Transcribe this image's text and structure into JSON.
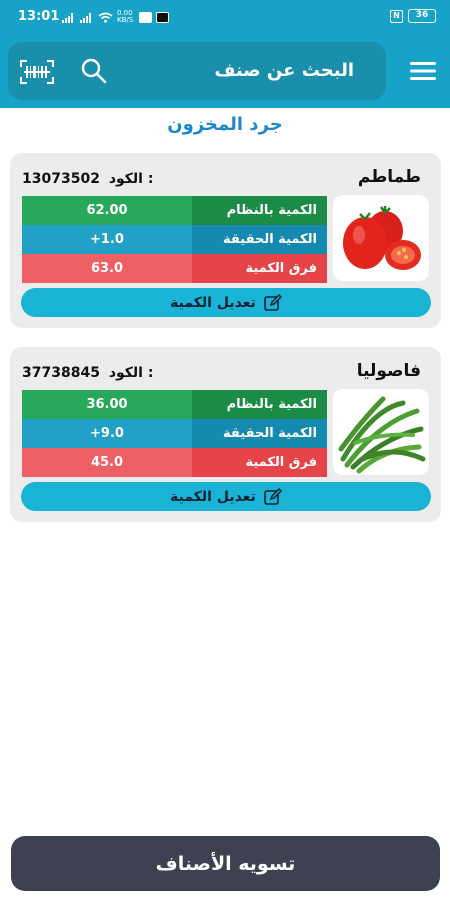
{
  "status_bar": {
    "time": "13:01",
    "data_speed": "0.00 KB/S",
    "battery": "36"
  },
  "app_bar": {
    "search_label": "البحث عن صنف",
    "menu_icon": "menu-icon",
    "search_icon": "search-icon",
    "barcode_icon": "barcode-scan-icon"
  },
  "page_title": "جرد المخزون",
  "colors": {
    "primary": "#17a2c8",
    "system_qty": "#1b8c46",
    "actual_qty": "#1689b0",
    "difference": "#e54448",
    "bottom_button": "#3d4150"
  },
  "items": [
    {
      "name": "طماطم",
      "code_label": "الكود :",
      "code": "13073502",
      "image": "tomato-image",
      "rows": [
        {
          "label": "الكمية بالنظام",
          "value": "62.00"
        },
        {
          "label": "الكمية الحقيقة",
          "value": "+1.0"
        },
        {
          "label": "فرق الكمية",
          "value": "63.0"
        }
      ],
      "edit_label": "تعديل الكمية"
    },
    {
      "name": "فاصوليا",
      "code_label": "الكود :",
      "code": "37738845",
      "image": "green-beans-image",
      "rows": [
        {
          "label": "الكمية بالنظام",
          "value": "36.00"
        },
        {
          "label": "الكمية الحقيقة",
          "value": "+9.0"
        },
        {
          "label": "فرق الكمية",
          "value": "45.0"
        }
      ],
      "edit_label": "تعديل الكمية"
    }
  ],
  "bottom_button_label": "تسويه الأصناف"
}
